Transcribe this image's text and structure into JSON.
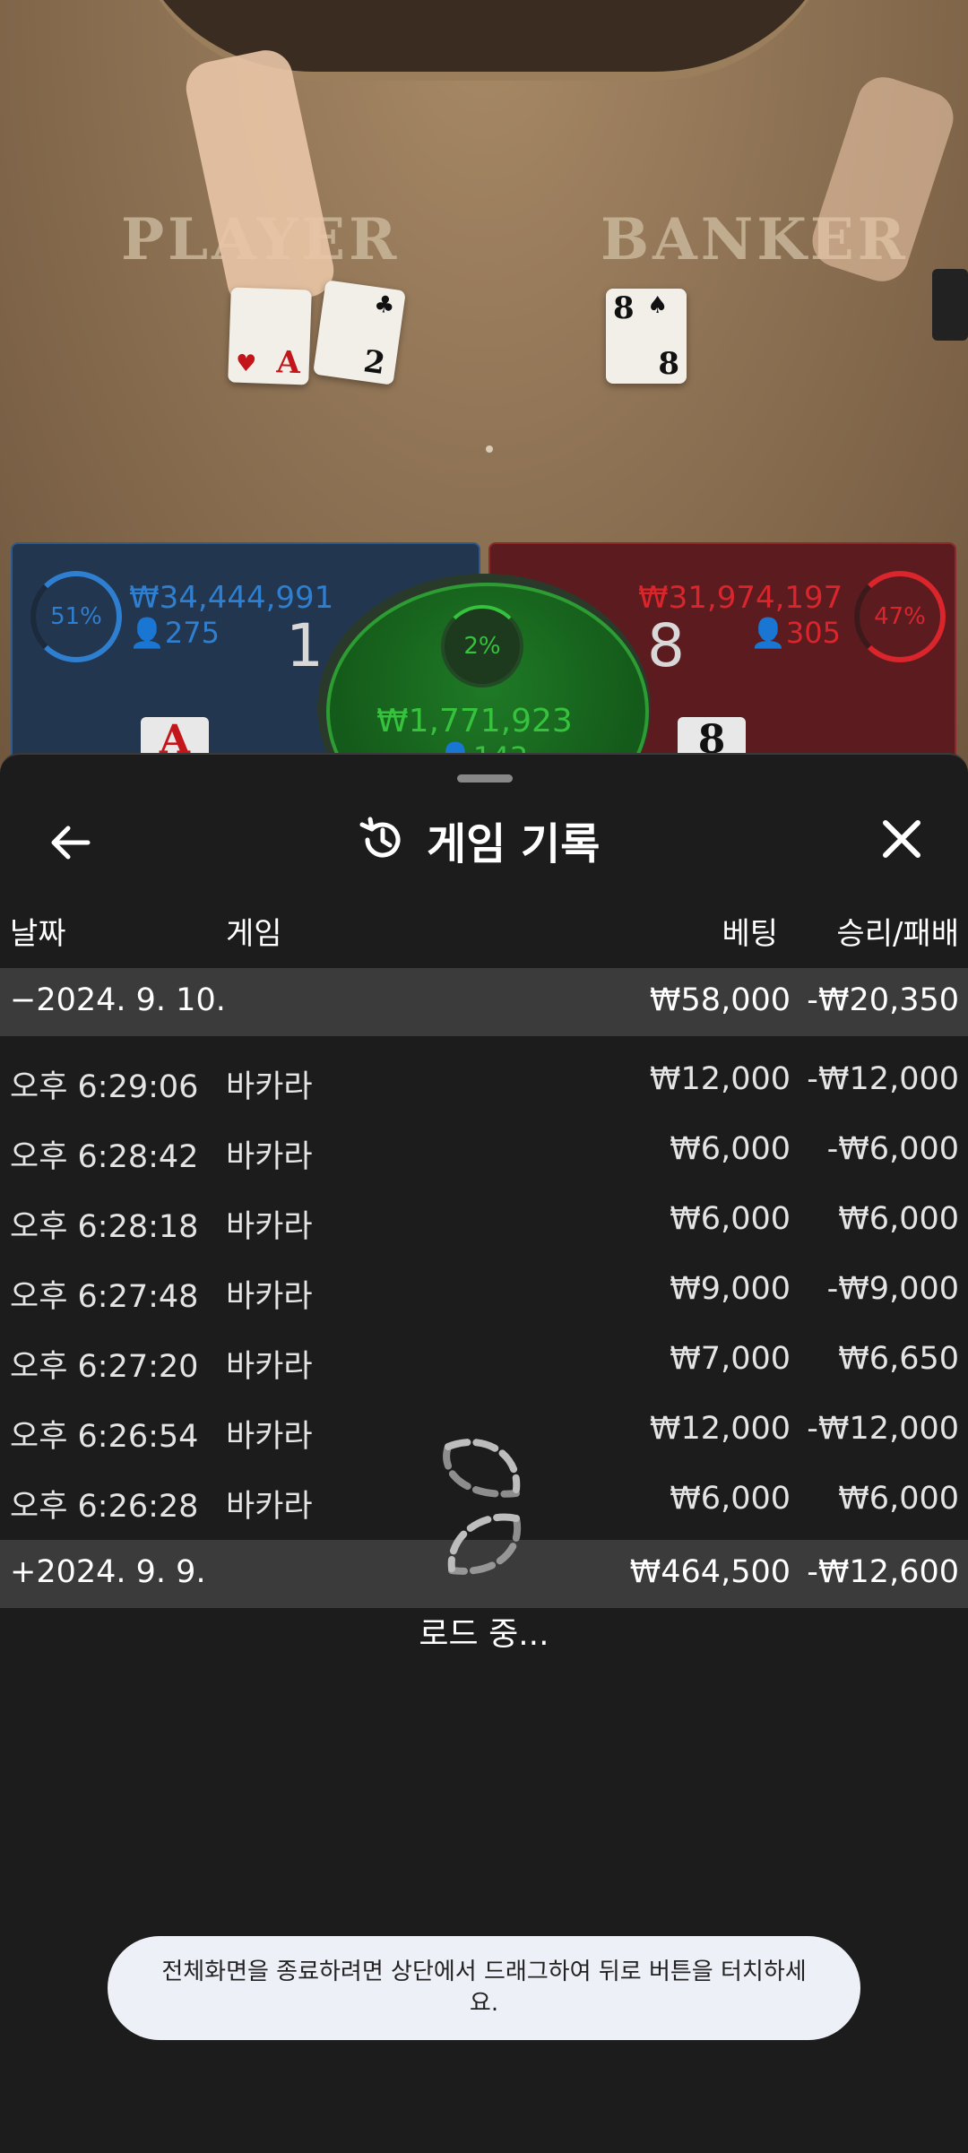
{
  "video": {
    "player_word": "PLAYER",
    "banker_word": "BANKER",
    "player_cards": [
      {
        "rank": "A",
        "suit": "♥"
      },
      {
        "rank": "2",
        "suit": "♣"
      }
    ],
    "banker_cards": [
      {
        "rank": "8",
        "suit": "♠"
      }
    ]
  },
  "bets": {
    "player": {
      "percent": "51%",
      "amount": "₩34,444,991",
      "players": "275",
      "score": "1",
      "card": "A",
      "color": "#2f7fd0"
    },
    "tie": {
      "percent": "2%",
      "amount": "₩1,771,923",
      "players": "143",
      "color": "#36c23d"
    },
    "banker": {
      "percent": "47%",
      "amount": "₩31,974,197",
      "players": "305",
      "score": "8",
      "card": "8",
      "color": "#d9252b"
    }
  },
  "sheet": {
    "title": "게임 기록",
    "back_icon": "arrow-left-icon",
    "close_icon": "close-icon",
    "history_icon": "history-icon",
    "columns": {
      "date": "날짜",
      "game": "게임",
      "bet": "베팅",
      "winloss": "승리/패배"
    },
    "groups": [
      {
        "date": "2024. 9. 10.",
        "toggle": "−",
        "bet": "₩58,000",
        "result": "-₩20,350",
        "rows": [
          {
            "time": "오후 6:29:06",
            "game": "바카라",
            "bet": "₩12,000",
            "result": "-₩12,000"
          },
          {
            "time": "오후 6:28:42",
            "game": "바카라",
            "bet": "₩6,000",
            "result": "-₩6,000"
          },
          {
            "time": "오후 6:28:18",
            "game": "바카라",
            "bet": "₩6,000",
            "result": "₩6,000"
          },
          {
            "time": "오후 6:27:48",
            "game": "바카라",
            "bet": "₩9,000",
            "result": "-₩9,000"
          },
          {
            "time": "오후 6:27:20",
            "game": "바카라",
            "bet": "₩7,000",
            "result": "₩6,650"
          },
          {
            "time": "오후 6:26:54",
            "game": "바카라",
            "bet": "₩12,000",
            "result": "-₩12,000"
          },
          {
            "time": "오후 6:26:28",
            "game": "바카라",
            "bet": "₩6,000",
            "result": "₩6,000"
          }
        ]
      },
      {
        "date": "2024. 9. 9.",
        "toggle": "+",
        "bet": "₩464,500",
        "result": "-₩12,600",
        "rows": []
      }
    ],
    "loading_text": "로드 중...",
    "toast": "전체화면을 종료하려면 상단에서 드래그하여 뒤로 버튼을 터치하세요."
  }
}
